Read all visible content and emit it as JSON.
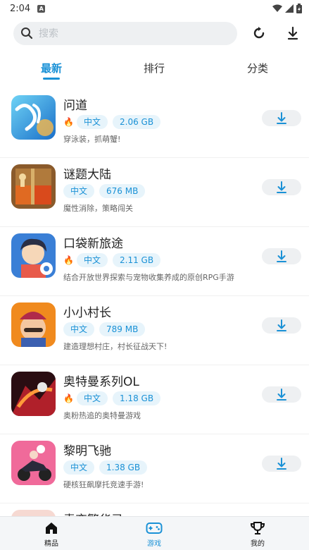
{
  "status_bar": {
    "time": "2:04",
    "notification_icon": "A"
  },
  "search": {
    "placeholder": "搜索"
  },
  "tabs": [
    {
      "label": "最新",
      "active": true
    },
    {
      "label": "排行",
      "active": false
    },
    {
      "label": "分类",
      "active": false
    }
  ],
  "apps": [
    {
      "name": "问道",
      "hot": true,
      "language": "中文",
      "size": "2.06 GB",
      "description": "穿泳装，抓萌蟹!"
    },
    {
      "name": "谜题大陆",
      "hot": false,
      "language": "中文",
      "size": "676 MB",
      "description": "魔性消除，策略闯关"
    },
    {
      "name": "口袋新旅途",
      "hot": true,
      "language": "中文",
      "size": "2.11 GB",
      "description": "结合开放世界探索与宠物收集养成的原创RPG手游"
    },
    {
      "name": "小小村长",
      "hot": false,
      "language": "中文",
      "size": "789 MB",
      "description": "建造理想村庄，村长征战天下!"
    },
    {
      "name": "奥特曼系列OL",
      "hot": true,
      "language": "中文",
      "size": "1.18 GB",
      "description": "奥粉热追的奥特曼游戏"
    },
    {
      "name": "黎明飞驰",
      "hot": false,
      "language": "中文",
      "size": "1.38 GB",
      "description": "硬核狂飙摩托竞速手游!"
    },
    {
      "name": "青恋繁华录",
      "hot": false,
      "language": "",
      "size": "",
      "description": ""
    }
  ],
  "bottom_nav": [
    {
      "label": "精品",
      "icon": "home-icon",
      "active": false
    },
    {
      "label": "游戏",
      "icon": "gamepad-icon",
      "active": true
    },
    {
      "label": "我的",
      "icon": "trophy-icon",
      "active": false
    }
  ],
  "colors": {
    "accent": "#1a91d6",
    "tag_bg": "#e7f4fb",
    "hot": "#e8452b"
  }
}
